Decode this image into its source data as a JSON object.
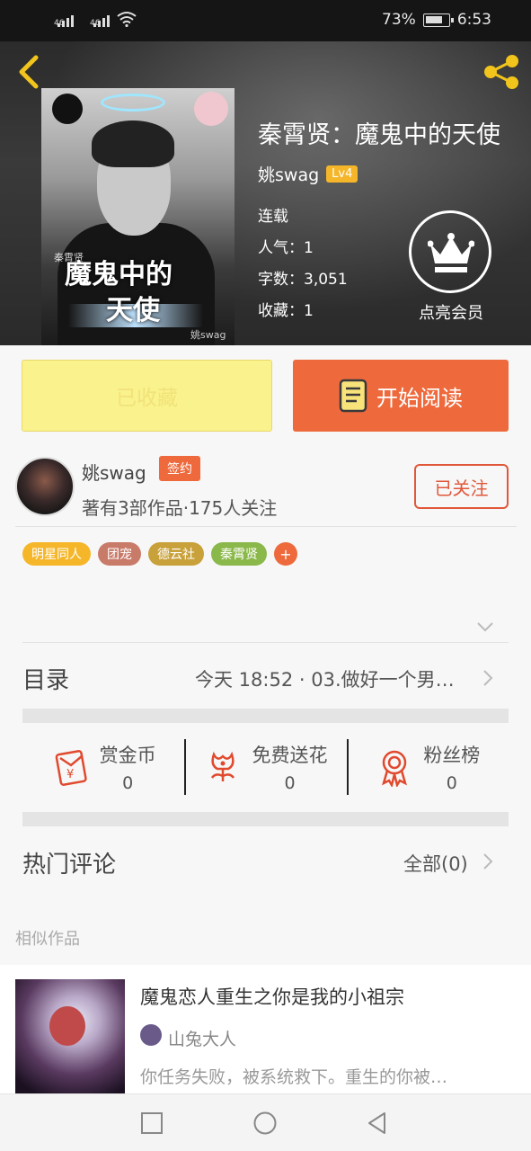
{
  "status_bar": {
    "signal1": "46",
    "signal2": "46",
    "battery": "73%",
    "time": "6:53"
  },
  "book": {
    "title": "秦霄贤：魔鬼中的天使",
    "author": "姚swag",
    "level": "Lv4",
    "status": "连载",
    "popularity": "人气：1",
    "word_count": "字数：3,051",
    "favorites": "收藏：1",
    "vip_label": "点亮会员",
    "cover_title_1": "魔鬼中的",
    "cover_title_2": "天使",
    "cover_signature": "姚swag",
    "cover_small": "秦霄贤"
  },
  "actions": {
    "favorite_label": "已收藏",
    "read_label": "开始阅读"
  },
  "author_block": {
    "name": "姚swag",
    "badge": "签约",
    "meta": "著有3部作品·175人关注",
    "follow_label": "已关注"
  },
  "tags": [
    {
      "label": "明星同人",
      "color": "#f5b629"
    },
    {
      "label": "团宠",
      "color": "#c97b6a"
    },
    {
      "label": "德云社",
      "color": "#c9a13a"
    },
    {
      "label": "秦霄贤",
      "color": "#8bb84a"
    }
  ],
  "tag_add": "+",
  "toc": {
    "label": "目录",
    "latest": "今天 18:52 · 03.做好一个男…"
  },
  "support": [
    {
      "label": "赏金币",
      "count": "0",
      "icon": "red-envelope-icon"
    },
    {
      "label": "免费送花",
      "count": "0",
      "icon": "flower-icon"
    },
    {
      "label": "粉丝榜",
      "count": "0",
      "icon": "medal-icon"
    }
  ],
  "comments": {
    "label": "热门评论",
    "all": "全部(0)"
  },
  "similar": {
    "heading": "相似作品",
    "items": [
      {
        "title": "魔鬼恋人重生之你是我的小祖宗",
        "author": "山兔大人",
        "desc": "你任务失败，被系统救下。重生的你被…"
      }
    ]
  },
  "colors": {
    "accent": "#ee6a3c",
    "favorite_bg": "#faf28d",
    "level_badge": "#f5b629"
  }
}
